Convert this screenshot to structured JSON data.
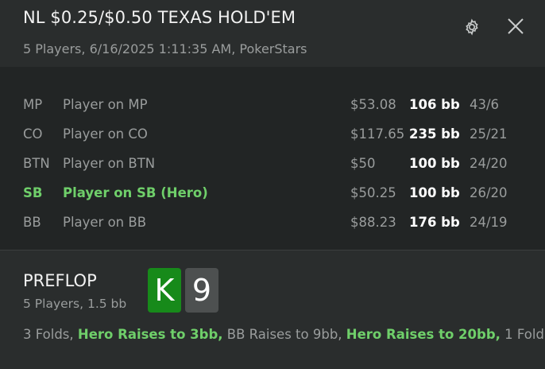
{
  "header": {
    "title": "NL $0.25/$0.50 TEXAS HOLD'EM",
    "subtitle": "5 Players, 6/16/2025 1:11:35 AM, PokerStars",
    "icons": [
      "gear-icon",
      "close-icon"
    ]
  },
  "players": [
    {
      "pos": "MP",
      "name": "Player on MP",
      "stack": "$53.08",
      "bb": "106 bb",
      "stat": "43/6",
      "hero": false
    },
    {
      "pos": "CO",
      "name": "Player on CO",
      "stack": "$117.65",
      "bb": "235 bb",
      "stat": "25/21",
      "hero": false
    },
    {
      "pos": "BTN",
      "name": "Player on BTN",
      "stack": "$50",
      "bb": "100 bb",
      "stat": "24/20",
      "hero": false
    },
    {
      "pos": "SB",
      "name": "Player on SB (Hero)",
      "stack": "$50.25",
      "bb": "100 bb",
      "stat": "26/20",
      "hero": true
    },
    {
      "pos": "BB",
      "name": "Player on BB",
      "stack": "$88.23",
      "bb": "176 bb",
      "stat": "24/19",
      "hero": false
    }
  ],
  "street": {
    "name": "PREFLOP",
    "info": "5 Players, 1.5 bb",
    "cards": [
      {
        "rank": "K",
        "color": "#178a1a"
      },
      {
        "rank": "9",
        "color": "#4d5050"
      }
    ],
    "actions": [
      {
        "text": "3 Folds, ",
        "hero": false
      },
      {
        "text": "Hero Raises to 3bb,",
        "hero": true
      },
      {
        "text": " BB Raises to 9bb, ",
        "hero": false
      },
      {
        "text": "Hero Raises to 20bb,",
        "hero": true
      },
      {
        "text": " 1 Fold",
        "hero": false
      }
    ]
  },
  "colors": {
    "hero": "#6fcf6a",
    "muted": "#9a9d9d",
    "background": "#2a2d2d",
    "panel": "#222525"
  }
}
